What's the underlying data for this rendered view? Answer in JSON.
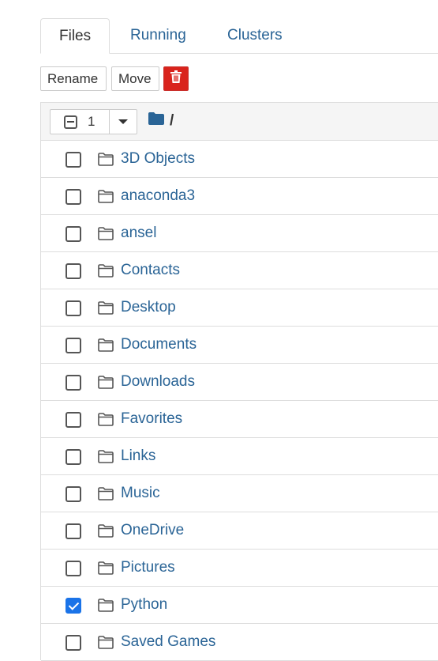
{
  "tabs": [
    {
      "label": "Files",
      "active": true
    },
    {
      "label": "Running",
      "active": false
    },
    {
      "label": "Clusters",
      "active": false
    }
  ],
  "toolbar": {
    "rename_label": "Rename",
    "move_label": "Move",
    "delete_icon": "trash-icon"
  },
  "list_header": {
    "selected_count": "1",
    "path": "/"
  },
  "items": [
    {
      "name": "3D Objects",
      "checked": false
    },
    {
      "name": "anaconda3",
      "checked": false
    },
    {
      "name": "ansel",
      "checked": false
    },
    {
      "name": "Contacts",
      "checked": false
    },
    {
      "name": "Desktop",
      "checked": false
    },
    {
      "name": "Documents",
      "checked": false
    },
    {
      "name": "Downloads",
      "checked": false
    },
    {
      "name": "Favorites",
      "checked": false
    },
    {
      "name": "Links",
      "checked": false
    },
    {
      "name": "Music",
      "checked": false
    },
    {
      "name": "OneDrive",
      "checked": false
    },
    {
      "name": "Pictures",
      "checked": false
    },
    {
      "name": "Python",
      "checked": true
    },
    {
      "name": "Saved Games",
      "checked": false
    }
  ],
  "colors": {
    "link": "#2a6496",
    "danger": "#d9231c",
    "checked": "#1a73e8"
  }
}
